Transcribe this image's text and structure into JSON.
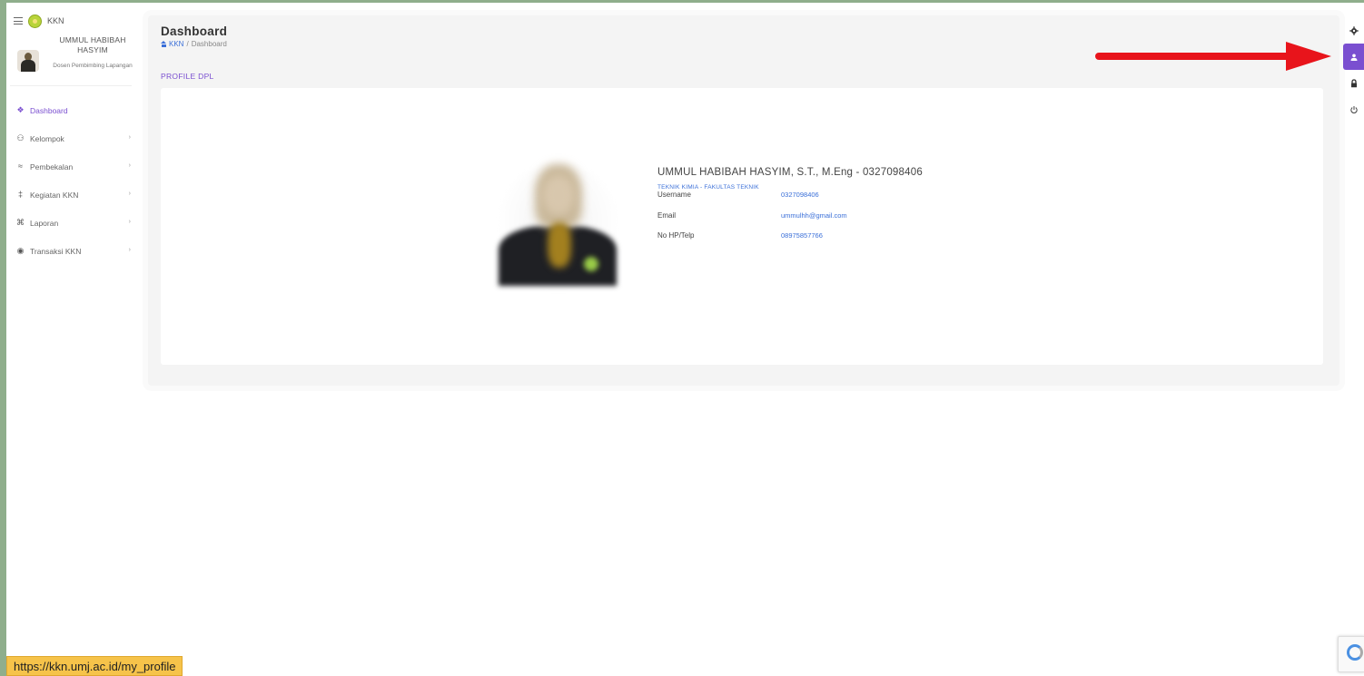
{
  "app": {
    "brand": "KKN"
  },
  "user": {
    "name": "UMMUL HABIBAH HASYIM",
    "role": "Dosen Pembimbing Lapangan"
  },
  "sidebar": {
    "items": [
      {
        "label": "Dashboard",
        "icon": "dashboard-icon",
        "active": true
      },
      {
        "label": "Kelompok",
        "icon": "group-icon",
        "has_submenu": true
      },
      {
        "label": "Pembekalan",
        "icon": "layers-icon",
        "has_submenu": true
      },
      {
        "label": "Kegiatan KKN",
        "icon": "activity-icon",
        "has_submenu": true
      },
      {
        "label": "Laporan",
        "icon": "report-icon",
        "has_submenu": true
      },
      {
        "label": "Transaksi KKN",
        "icon": "transaction-icon",
        "has_submenu": true
      }
    ]
  },
  "page": {
    "title": "Dashboard",
    "breadcrumb": [
      "KKN",
      "/",
      "Dashboard"
    ],
    "section_label": "PROFILE DPL"
  },
  "profile": {
    "header": "UMMUL HABIBAH HASYIM, S.T., M.Eng - 0327098406",
    "department": "TEKNIK KIMIA - FAKULTAS TEKNIK",
    "fields": [
      {
        "key": "Username",
        "value": "0327098406"
      },
      {
        "key": "Email",
        "value": "ummulhh@gmail.com"
      },
      {
        "key": "No HP/Telp",
        "value": "08975857766"
      }
    ]
  },
  "rail": {
    "items": [
      "gear-icon",
      "user-profile-icon",
      "lock-icon",
      "power-icon"
    ],
    "active_index": 1
  },
  "status_bar": {
    "url": "https://kkn.umj.ac.id/my_profile"
  },
  "colors": {
    "accent": "#7a4fd0",
    "link": "#3a6fd8",
    "annotation_arrow": "#e8141b",
    "status_bar": "#f6c34a"
  }
}
